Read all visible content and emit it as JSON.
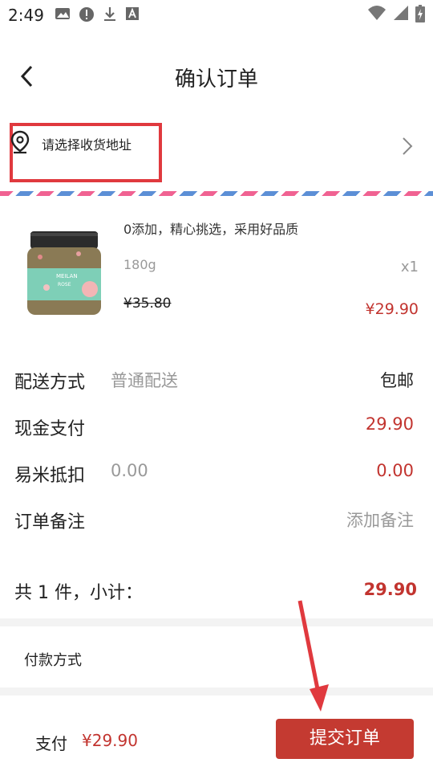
{
  "statusbar": {
    "time": "2:49",
    "icons_left": [
      "image-icon",
      "alert-icon",
      "download-icon",
      "font-icon"
    ],
    "icons_right": [
      "wifi-icon",
      "signal-icon",
      "battery-icon"
    ]
  },
  "header": {
    "title": "确认订单"
  },
  "address": {
    "label": "请选择收货地址"
  },
  "product": {
    "name": "0添加，精心挑选，采用好品质",
    "spec": "180g",
    "qty": "x1",
    "original_price": "¥35.80",
    "price": "¥29.90",
    "image_label": "MEILAN",
    "image_label2": "ROSE"
  },
  "order_rows": [
    {
      "label": "配送方式",
      "sub": "普通配送",
      "value": "包邮"
    },
    {
      "label": "现金支付",
      "sub": "",
      "value": "29.90"
    },
    {
      "label": "易米抵扣",
      "sub": "0.00",
      "value": "0.00"
    },
    {
      "label": "订单备注",
      "sub": "",
      "value": "添加备注"
    }
  ],
  "subtotal": {
    "label": "共 1 件，小计：",
    "value": "29.90"
  },
  "payment_method": {
    "label": "付款方式"
  },
  "bottom_bar": {
    "pay_label": "支付",
    "pay_amount": "¥29.90",
    "submit_label": "提交订单"
  },
  "colors": {
    "accent_red": "#c43a31",
    "annotation_red": "#e0393e"
  }
}
